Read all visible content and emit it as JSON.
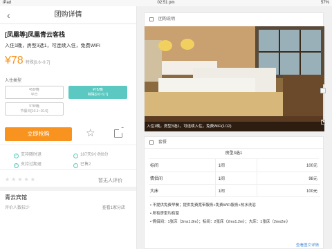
{
  "statusbar": {
    "device": "iPad",
    "time": "02:51 pm",
    "battery": "57%"
  },
  "left": {
    "nav_title": "团购详情",
    "back_glyph": "‹",
    "product_title": "[凤凰等]凤凰青云客栈",
    "product_desc": "入住1晚，房型3选1，可连续入住，免费WiFi",
    "price": "¥78",
    "price_note": "特殊[9.6~9.7]",
    "room_type_label": "入住类型",
    "options": [
      {
        "line1": "¥58/晚",
        "line2": "平日"
      },
      {
        "line1": "¥78/晚",
        "line2": "特殊[9.6~9.7]"
      },
      {
        "line1": "¥78/晚",
        "line2": "节假日[10.1~10.6]"
      }
    ],
    "buy_label": "立即抢购",
    "features": [
      {
        "icon": "check-circle-icon",
        "text": "支持随时退"
      },
      {
        "icon": "clock-icon",
        "text": "187天9小时8分"
      },
      {
        "icon": "check-circle-icon",
        "text": "支持过期退"
      },
      {
        "icon": "user-icon",
        "text": "已售2"
      }
    ],
    "no_reviews": "暂无人评价",
    "hotel_name": "青云宾馆",
    "hotel_reviews": "评价人数较少",
    "all_branches": "查看1家分店"
  },
  "right": {
    "section_title": "团购说明",
    "photo_caption": "入住1晚，房型3选1，可连续入住，免费WiFi(1/12)",
    "package_title": "套餐",
    "room_header": "房型3选1",
    "rows": [
      {
        "name": "标间",
        "qty": "1间",
        "price": "100元"
      },
      {
        "name": "情侣间",
        "qty": "1间",
        "price": "98元"
      },
      {
        "name": "大床",
        "qty": "1间",
        "price": "100元"
      }
    ],
    "note1": "• 不提供免费早餐；提供免费宽带服务+免费WiFi服务+热水洗浴",
    "note2": "• 所有房型均有窗",
    "note3": "• 情侣间：1张床（2mx1.8m）；标间：2张床（2mx1.2m）；大床：1张床（2mx2m）",
    "more_link": "查看图文详情"
  },
  "colors": {
    "accent": "#f7931e",
    "selected": "#5bc8c1",
    "link": "#4a90d9"
  }
}
